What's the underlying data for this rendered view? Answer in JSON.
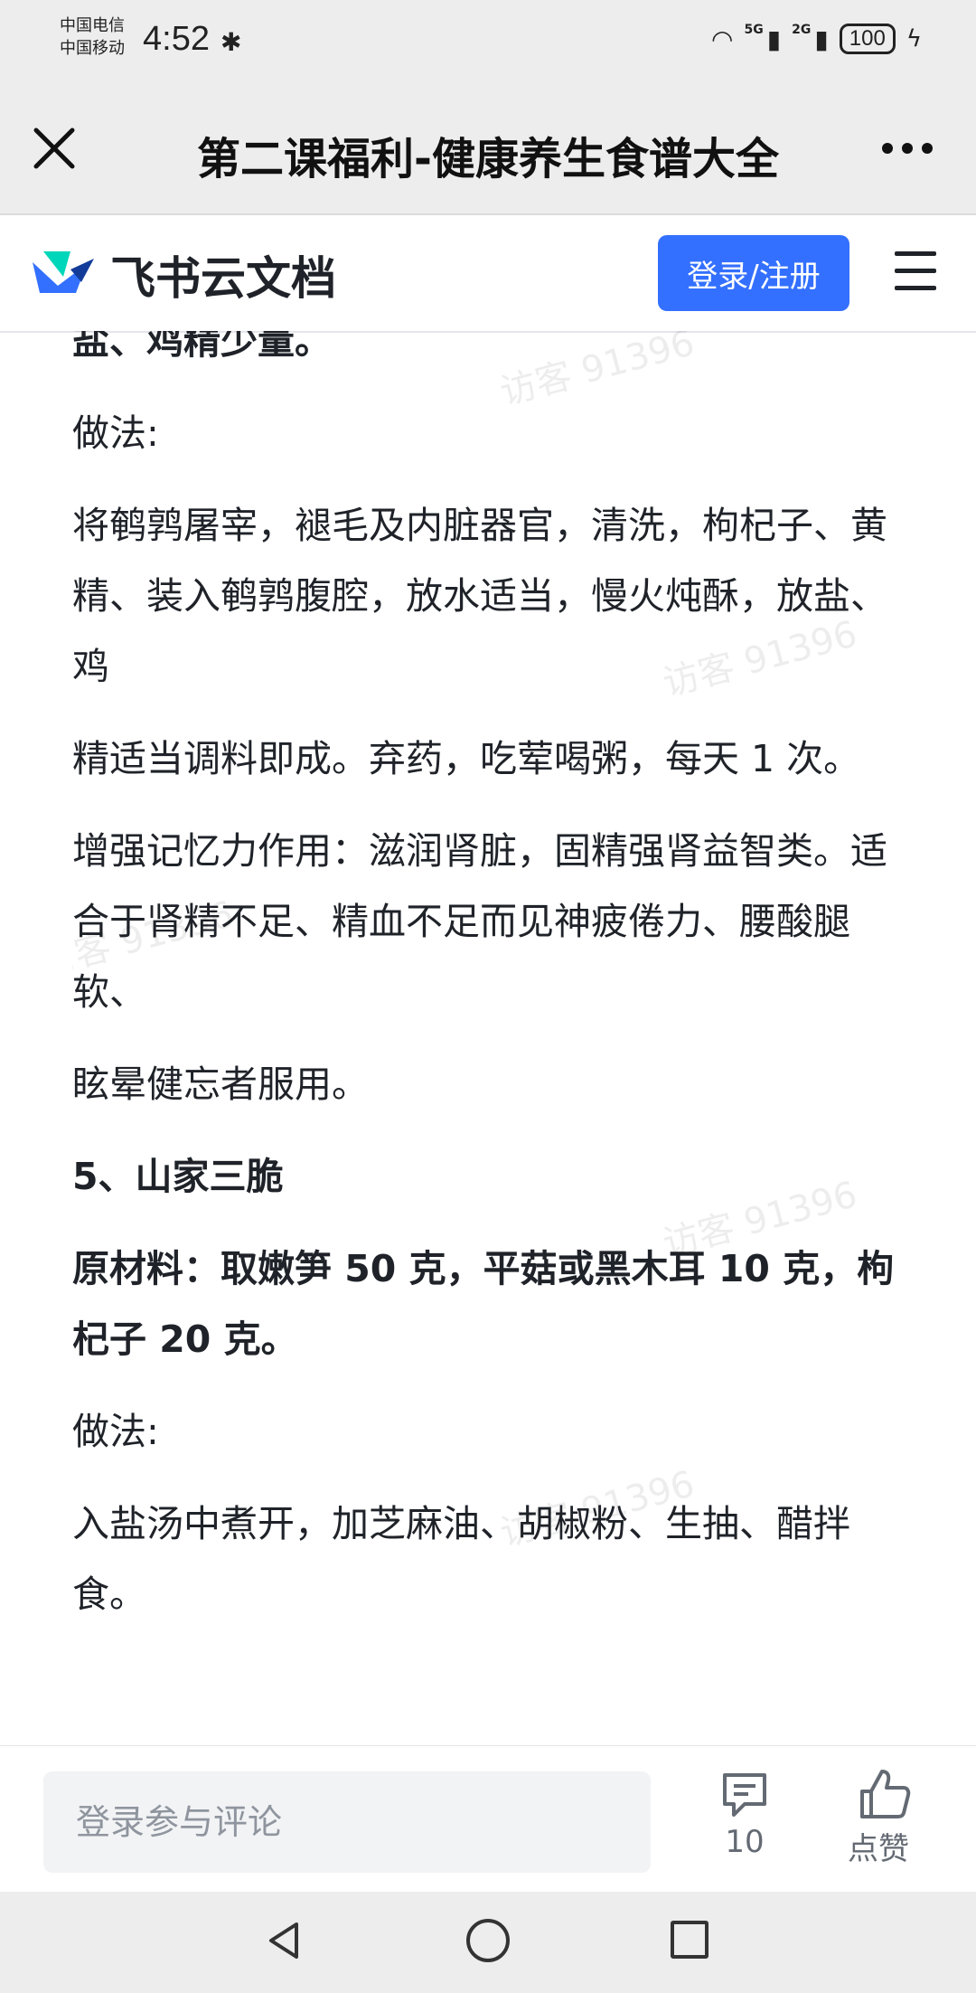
{
  "status": {
    "carrier1": "中国电信",
    "carrier2": "中国移动",
    "time": "4:52",
    "net1": "5G",
    "net2": "2G",
    "battery": "100"
  },
  "title_bar": {
    "title": "第二课福利-健康养生食谱大全"
  },
  "header": {
    "brand": "飞书云文档",
    "login_label": "登录/注册"
  },
  "content": {
    "paragraphs": [
      {
        "text": "盐、鸡精少量。",
        "bold": true
      },
      {
        "text": "做法:",
        "bold": false
      },
      {
        "text": "将鹌鹑屠宰，褪毛及内脏器官，清洗，枸杞子、黄精、装入鹌鹑腹腔，放水适当，慢火炖酥，放盐、鸡",
        "bold": false
      },
      {
        "text": "精适当调料即成。弃药，吃荤喝粥，每天 1 次。",
        "bold": false
      },
      {
        "text": "增强记忆力作用：滋润肾脏，固精强肾益智类。适合于肾精不足、精血不足而见神疲倦力、腰酸腿软、",
        "bold": false
      },
      {
        "text": "眩晕健忘者服用。",
        "bold": false
      },
      {
        "text": "5、山家三脆",
        "bold": true
      },
      {
        "text": "原材料：取嫩笋 50 克，平菇或黑木耳 10 克，枸杞子 20 克。",
        "bold": true
      },
      {
        "text": "做法:",
        "bold": false
      },
      {
        "text": "入盐汤中煮开，加芝麻油、胡椒粉、生抽、醋拌食。",
        "bold": false
      }
    ],
    "watermark": "访客 91396"
  },
  "bottom": {
    "comment_placeholder": "登录参与评论",
    "comment_count": "10",
    "like_label": "点赞"
  }
}
